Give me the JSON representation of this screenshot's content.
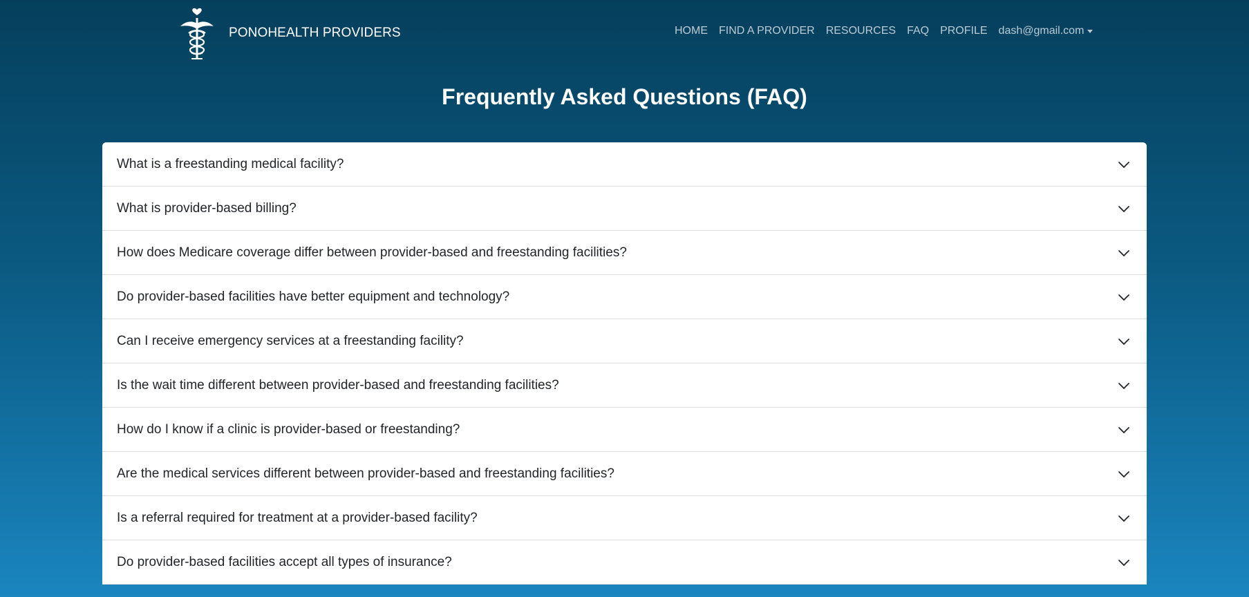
{
  "brand": {
    "name": "PONOHEALTH PROVIDERS",
    "logo_icon": "caduceus-heart-icon"
  },
  "nav": {
    "items": [
      "HOME",
      "FIND A PROVIDER",
      "RESOURCES",
      "FAQ",
      "PROFILE"
    ],
    "user_email": "dash@gmail.com"
  },
  "page": {
    "title": "Frequently Asked Questions (FAQ)"
  },
  "faq": {
    "questions": [
      "What is a freestanding medical facility?",
      "What is provider-based billing?",
      "How does Medicare coverage differ between provider-based and freestanding facilities?",
      "Do provider-based facilities have better equipment and technology?",
      "Can I receive emergency services at a freestanding facility?",
      "Is the wait time different between provider-based and freestanding facilities?",
      "How do I know if a clinic is provider-based or freestanding?",
      "Are the medical services different between provider-based and freestanding facilities?",
      "Is a referral required for treatment at a provider-based facility?",
      "Do provider-based facilities accept all types of insurance?"
    ],
    "toggle_icon": "chevron-down-icon"
  },
  "colors": {
    "background_top": "#053f5c",
    "background_bottom": "#1a85bf",
    "panel": "#ffffff",
    "question_text": "#212529",
    "divider": "#dee2e6"
  }
}
